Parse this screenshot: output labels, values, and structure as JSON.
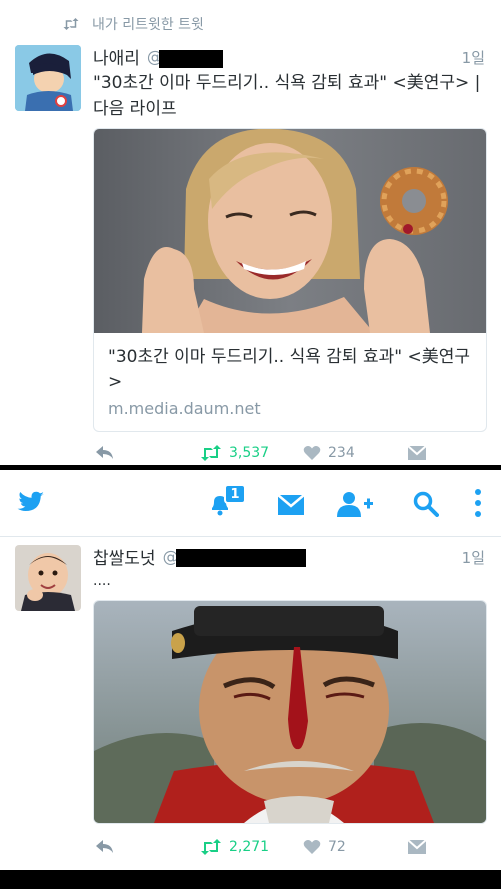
{
  "retweet_context": {
    "label": "내가 리트윗한 트윗"
  },
  "tweet1": {
    "author": "나애리",
    "handle_prefix": "@",
    "time": "1일",
    "text": "\"30초간 이마 두드리기.. 식욕 감퇴 효과\" <美연구> | 다음 라이프",
    "card": {
      "title": "\"30초간 이마 두드리기.. 식욕 감퇴 효과\" <美연구>",
      "domain": "m.media.daum.net"
    },
    "retweets": "3,537",
    "likes": "234"
  },
  "navbar": {
    "notification_badge": "1"
  },
  "tweet2": {
    "author": "찹쌀도넛",
    "handle_prefix": "@",
    "time": "1일",
    "text": "....",
    "retweets": "2,271",
    "likes": "72"
  },
  "colors": {
    "accent": "#1da1f2",
    "retweet_green": "#19cf86",
    "meta_gray": "#8899a6"
  }
}
